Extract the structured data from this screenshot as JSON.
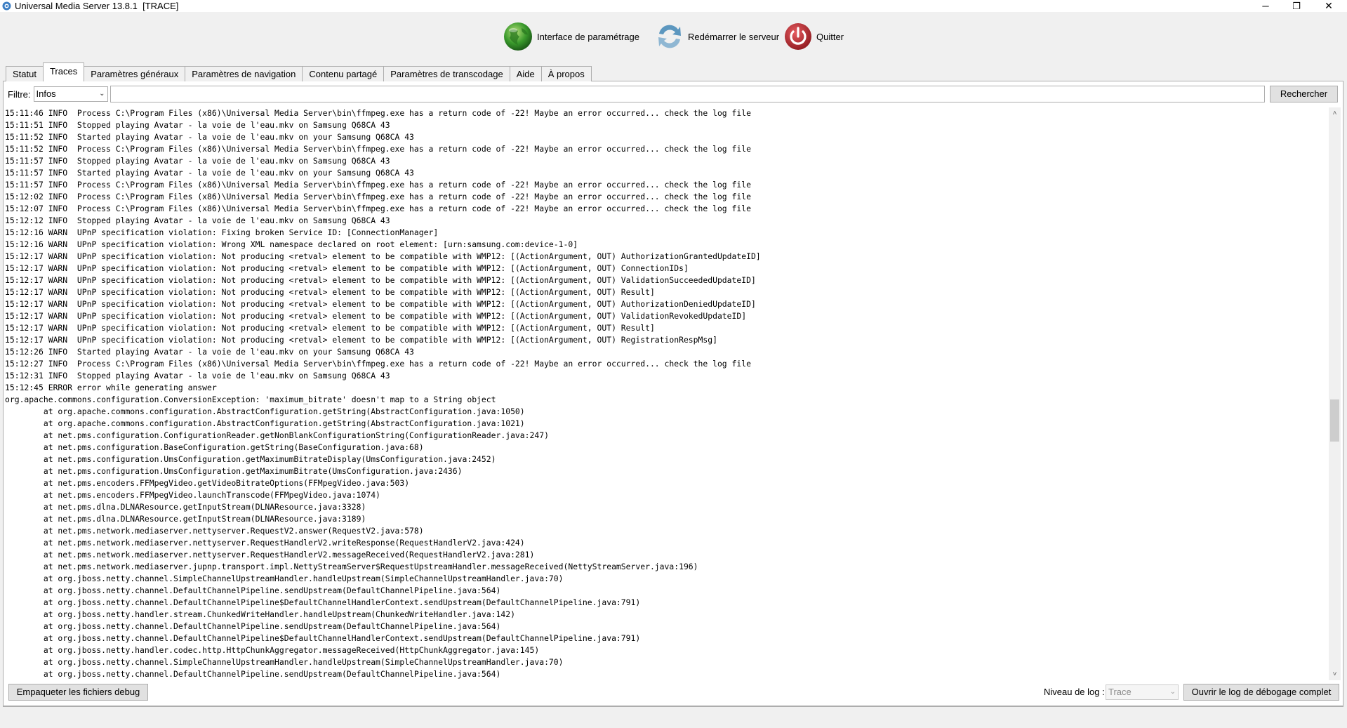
{
  "window": {
    "title": "Universal Media Server 13.8.1  [TRACE]",
    "controls": {
      "minimize": "─",
      "maximize": "❐",
      "close": "✕"
    }
  },
  "toolbar": {
    "config_label": "Interface de paramétrage",
    "restart_label": "Redémarrer le serveur",
    "quit_label": "Quitter"
  },
  "tabs": [
    {
      "label": "Statut"
    },
    {
      "label": "Traces"
    },
    {
      "label": "Paramètres généraux"
    },
    {
      "label": "Paramètres de navigation"
    },
    {
      "label": "Contenu partagé"
    },
    {
      "label": "Paramètres de transcodage"
    },
    {
      "label": "Aide"
    },
    {
      "label": "À propos"
    }
  ],
  "filter": {
    "label": "Filtre:",
    "selected": "Infos",
    "search_value": "",
    "search_button": "Rechercher"
  },
  "log": {
    "lines": [
      "15:11:46 INFO  Process C:\\Program Files (x86)\\Universal Media Server\\bin\\ffmpeg.exe has a return code of -22! Maybe an error occurred... check the log file",
      "15:11:51 INFO  Stopped playing Avatar - la voie de l'eau.mkv on Samsung Q68CA 43",
      "15:11:52 INFO  Started playing Avatar - la voie de l'eau.mkv on your Samsung Q68CA 43",
      "15:11:52 INFO  Process C:\\Program Files (x86)\\Universal Media Server\\bin\\ffmpeg.exe has a return code of -22! Maybe an error occurred... check the log file",
      "15:11:57 INFO  Stopped playing Avatar - la voie de l'eau.mkv on Samsung Q68CA 43",
      "15:11:57 INFO  Started playing Avatar - la voie de l'eau.mkv on your Samsung Q68CA 43",
      "15:11:57 INFO  Process C:\\Program Files (x86)\\Universal Media Server\\bin\\ffmpeg.exe has a return code of -22! Maybe an error occurred... check the log file",
      "15:12:02 INFO  Process C:\\Program Files (x86)\\Universal Media Server\\bin\\ffmpeg.exe has a return code of -22! Maybe an error occurred... check the log file",
      "15:12:07 INFO  Process C:\\Program Files (x86)\\Universal Media Server\\bin\\ffmpeg.exe has a return code of -22! Maybe an error occurred... check the log file",
      "15:12:12 INFO  Stopped playing Avatar - la voie de l'eau.mkv on Samsung Q68CA 43",
      "15:12:16 WARN  UPnP specification violation: Fixing broken Service ID: [ConnectionManager]",
      "15:12:16 WARN  UPnP specification violation: Wrong XML namespace declared on root element: [urn:samsung.com:device-1-0]",
      "15:12:17 WARN  UPnP specification violation: Not producing <retval> element to be compatible with WMP12: [(ActionArgument, OUT) AuthorizationGrantedUpdateID]",
      "15:12:17 WARN  UPnP specification violation: Not producing <retval> element to be compatible with WMP12: [(ActionArgument, OUT) ConnectionIDs]",
      "15:12:17 WARN  UPnP specification violation: Not producing <retval> element to be compatible with WMP12: [(ActionArgument, OUT) ValidationSucceededUpdateID]",
      "15:12:17 WARN  UPnP specification violation: Not producing <retval> element to be compatible with WMP12: [(ActionArgument, OUT) Result]",
      "15:12:17 WARN  UPnP specification violation: Not producing <retval> element to be compatible with WMP12: [(ActionArgument, OUT) AuthorizationDeniedUpdateID]",
      "15:12:17 WARN  UPnP specification violation: Not producing <retval> element to be compatible with WMP12: [(ActionArgument, OUT) ValidationRevokedUpdateID]",
      "15:12:17 WARN  UPnP specification violation: Not producing <retval> element to be compatible with WMP12: [(ActionArgument, OUT) Result]",
      "15:12:17 WARN  UPnP specification violation: Not producing <retval> element to be compatible with WMP12: [(ActionArgument, OUT) RegistrationRespMsg]",
      "15:12:26 INFO  Started playing Avatar - la voie de l'eau.mkv on your Samsung Q68CA 43",
      "15:12:27 INFO  Process C:\\Program Files (x86)\\Universal Media Server\\bin\\ffmpeg.exe has a return code of -22! Maybe an error occurred... check the log file",
      "15:12:31 INFO  Stopped playing Avatar - la voie de l'eau.mkv on Samsung Q68CA 43",
      "15:12:45 ERROR error while generating answer",
      "org.apache.commons.configuration.ConversionException: 'maximum_bitrate' doesn't map to a String object",
      "        at org.apache.commons.configuration.AbstractConfiguration.getString(AbstractConfiguration.java:1050)",
      "        at org.apache.commons.configuration.AbstractConfiguration.getString(AbstractConfiguration.java:1021)",
      "        at net.pms.configuration.ConfigurationReader.getNonBlankConfigurationString(ConfigurationReader.java:247)",
      "        at net.pms.configuration.BaseConfiguration.getString(BaseConfiguration.java:68)",
      "        at net.pms.configuration.UmsConfiguration.getMaximumBitrateDisplay(UmsConfiguration.java:2452)",
      "        at net.pms.configuration.UmsConfiguration.getMaximumBitrate(UmsConfiguration.java:2436)",
      "        at net.pms.encoders.FFMpegVideo.getVideoBitrateOptions(FFMpegVideo.java:503)",
      "        at net.pms.encoders.FFMpegVideo.launchTranscode(FFMpegVideo.java:1074)",
      "        at net.pms.dlna.DLNAResource.getInputStream(DLNAResource.java:3328)",
      "        at net.pms.dlna.DLNAResource.getInputStream(DLNAResource.java:3189)",
      "        at net.pms.network.mediaserver.nettyserver.RequestV2.answer(RequestV2.java:578)",
      "        at net.pms.network.mediaserver.nettyserver.RequestHandlerV2.writeResponse(RequestHandlerV2.java:424)",
      "        at net.pms.network.mediaserver.nettyserver.RequestHandlerV2.messageReceived(RequestHandlerV2.java:281)",
      "        at net.pms.network.mediaserver.jupnp.transport.impl.NettyStreamServer$RequestUpstreamHandler.messageReceived(NettyStreamServer.java:196)",
      "        at org.jboss.netty.channel.SimpleChannelUpstreamHandler.handleUpstream(SimpleChannelUpstreamHandler.java:70)",
      "        at org.jboss.netty.channel.DefaultChannelPipeline.sendUpstream(DefaultChannelPipeline.java:564)",
      "        at org.jboss.netty.channel.DefaultChannelPipeline$DefaultChannelHandlerContext.sendUpstream(DefaultChannelPipeline.java:791)",
      "        at org.jboss.netty.handler.stream.ChunkedWriteHandler.handleUpstream(ChunkedWriteHandler.java:142)",
      "        at org.jboss.netty.channel.DefaultChannelPipeline.sendUpstream(DefaultChannelPipeline.java:564)",
      "        at org.jboss.netty.channel.DefaultChannelPipeline$DefaultChannelHandlerContext.sendUpstream(DefaultChannelPipeline.java:791)",
      "        at org.jboss.netty.handler.codec.http.HttpChunkAggregator.messageReceived(HttpChunkAggregator.java:145)",
      "        at org.jboss.netty.channel.SimpleChannelUpstreamHandler.handleUpstream(SimpleChannelUpstreamHandler.java:70)",
      "        at org.jboss.netty.channel.DefaultChannelPipeline.sendUpstream(DefaultChannelPipeline.java:564)"
    ]
  },
  "bottom": {
    "pack_button": "Empaqueter les fichiers debug",
    "loglevel_label": "Niveau de log :",
    "loglevel_selected": "Trace",
    "open_full_log_button": "Ouvrir le log de débogage complet"
  },
  "colors": {
    "accent_green": "#3a9a2c",
    "restart_blue": "#5c97bf",
    "quit_red": "#c0272d"
  }
}
